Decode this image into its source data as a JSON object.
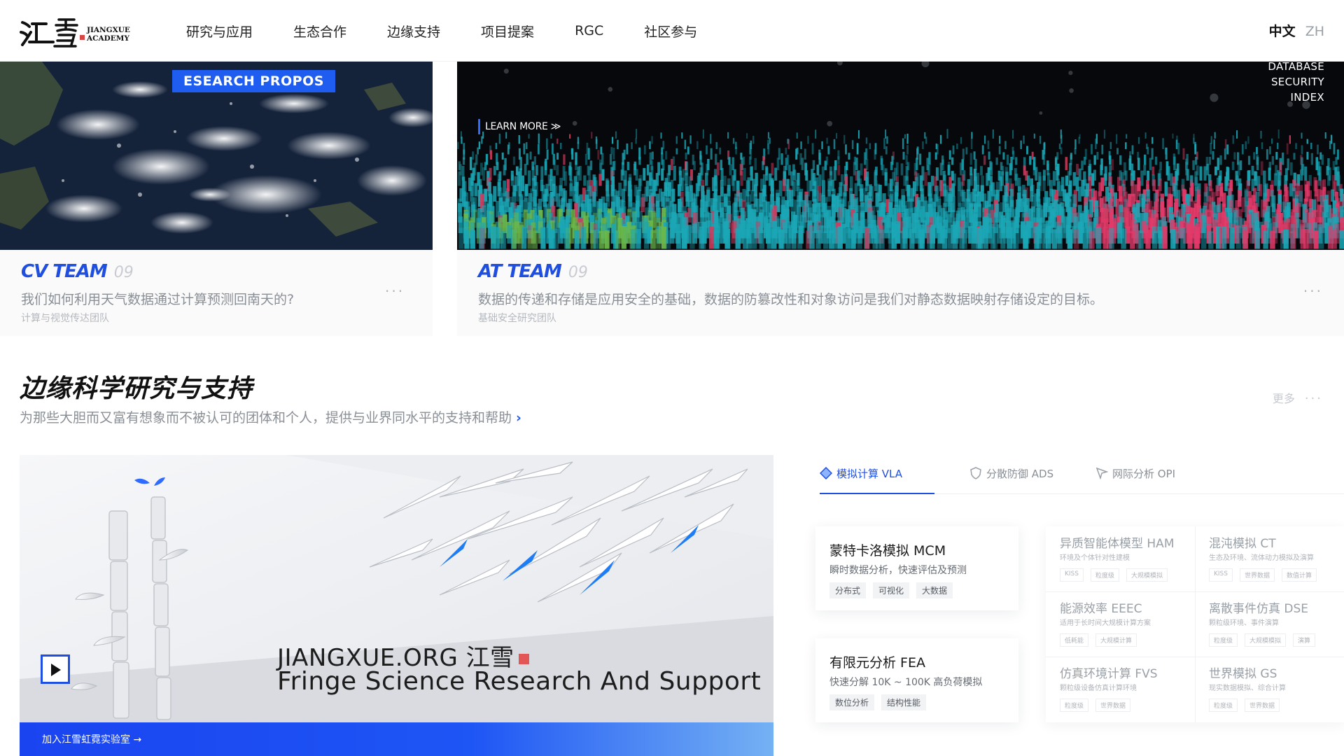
{
  "header": {
    "logo_cn": "江雪",
    "logo_en_line1": "JIANGXUE",
    "logo_en_line2": "ACADEMY",
    "nav": [
      "研究与应用",
      "生态合作",
      "边缘支持",
      "项目提案",
      "RGC",
      "社区参与"
    ],
    "lang_active": "中文",
    "lang_alt": "ZH"
  },
  "cards": {
    "cv": {
      "image_tag": "ESEARCH PROPOS",
      "title": "CV TEAM",
      "number": "09",
      "desc": "我们如何利用天气数据通过计算预测回南天的?",
      "sub": "计算与视觉传达团队",
      "dots": "···"
    },
    "at": {
      "learn_more": "LEARN MORE ≫",
      "overlay_lines": [
        "DATABASE",
        "SECURITY",
        "INDEX"
      ],
      "title": "AT TEAM",
      "number": "09",
      "desc": "数据的传递和存储是应用安全的基础，数据的防篡改性和对象访问是我们对静态数据映射存储设定的目标。",
      "sub": "基础安全研究团队",
      "dots": "···"
    }
  },
  "section": {
    "title": "边缘科学研究与支持",
    "subtitle": "为那些大胆而又富有想象而不被认可的团体和个人，提供与业界同水平的支持和帮助",
    "subtitle_chevron": "›",
    "more": "更多",
    "more_dots": "···"
  },
  "hero": {
    "title": "JIANGXUE.ORG 江雪",
    "subtitle": "Fringe Science Research And Support",
    "bar_text": "加入江雪虹霓实验室 →",
    "accent": "#1f4fe0"
  },
  "panel": {
    "tabs": [
      {
        "label": "模拟计算 VLA",
        "icon": "diamond-icon",
        "active": true
      },
      {
        "label": "分散防御 ADS",
        "icon": "shield-icon",
        "active": false
      },
      {
        "label": "网际分析 OPI",
        "icon": "cursor-icon",
        "active": false
      }
    ],
    "featured": [
      {
        "title": "蒙特卡洛模拟 MCM",
        "desc": "瞬时数据分析，快速评估及预测",
        "chips": [
          "分布式",
          "可视化",
          "大数据"
        ]
      },
      {
        "title": "有限元分析 FEA",
        "desc": "快速分解 10K ~ 100K 高负荷模拟",
        "chips": [
          "数位分析",
          "结构性能"
        ]
      }
    ],
    "grid": [
      {
        "title": "异质智能体模型 HAM",
        "desc": "环境及个体针对性建模",
        "chips": [
          "KISS",
          "粒度级",
          "大规模模拟"
        ]
      },
      {
        "title": "混沌模拟 CT",
        "desc": "生态及环境、流体动力模拟及演算",
        "chips": [
          "KISS",
          "世界数据",
          "数值计算"
        ]
      },
      {
        "title": "能源效率 EEEC",
        "desc": "适用于长时间大规模计算方案",
        "chips": [
          "低耗能",
          "大规模计算"
        ]
      },
      {
        "title": "离散事件仿真 DSE",
        "desc": "颗粒级环境、事件演算",
        "chips": [
          "粒度级",
          "大规模模拟",
          "演算"
        ]
      },
      {
        "title": "仿真环境计算 FVS",
        "desc": "颗粒级设备仿真计算环境",
        "chips": [
          "粒度级",
          "世界数据"
        ]
      },
      {
        "title": "世界模拟 GS",
        "desc": "现实数据模拟、综合计算",
        "chips": [
          "粒度级",
          "世界数据"
        ]
      }
    ]
  }
}
